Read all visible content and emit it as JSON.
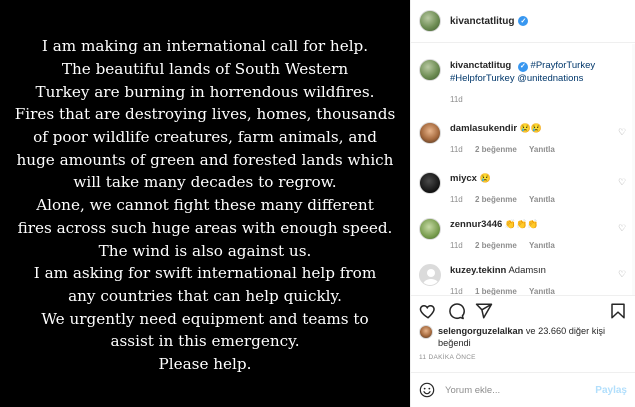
{
  "post": {
    "lines": [
      "I am making an international call for help.",
      "The beautiful lands of South Western",
      "Turkey are burning in horrendous wildfires.",
      "Fires that are destroying lives, homes, thousands",
      "of poor wildlife creatures, farm animals, and",
      "huge amounts of green and forested lands which",
      "will take many decades to regrow.",
      "Alone, we cannot fight these many different",
      "fires across such huge areas with enough speed.",
      "The wind is also against us.",
      "I am asking for swift international help from",
      "any countries that can help quickly.",
      "We urgently need  equipment and teams to",
      "assist in this emergency.",
      "Please help."
    ]
  },
  "header": {
    "username": "kivanctatlitug"
  },
  "caption": {
    "username": "kivanctatlitug",
    "text": "#PrayforTurkey #HelpforTurkey @unitednations",
    "age": "11d"
  },
  "comments": [
    {
      "username": "damlasukendir",
      "text": "😢😢",
      "age": "11d",
      "likes": "2 beğenme",
      "reply": "Yanıtla"
    },
    {
      "username": "miycx",
      "text": "😢",
      "age": "11d",
      "likes": "2 beğenme",
      "reply": "Yanıtla"
    },
    {
      "username": "zennur3446",
      "text": "👏👏👏",
      "age": "11d",
      "likes": "2 beğenme",
      "reply": "Yanıtla"
    },
    {
      "username": "kuzey.tekinn",
      "text": "Adamsın",
      "age": "11d",
      "likes": "1 beğenme",
      "reply": "Yanıtla"
    }
  ],
  "likes": {
    "liker": "selengorguzelalkan",
    "rest": " ve 23.660 diğer kişi beğendi"
  },
  "timeago": "11 DAKİKA ÖNCE",
  "comment_box": {
    "placeholder": "Yorum ekle...",
    "post_label": "Paylaş"
  },
  "icons": [
    "heart-icon",
    "comment-icon",
    "share-icon",
    "bookmark-icon",
    "smiley-icon",
    "verified-icon"
  ],
  "colors": {
    "link": "#00376b",
    "verified": "#3897f0",
    "muted": "#8e8e8e",
    "post_button": "#b2dffc"
  }
}
